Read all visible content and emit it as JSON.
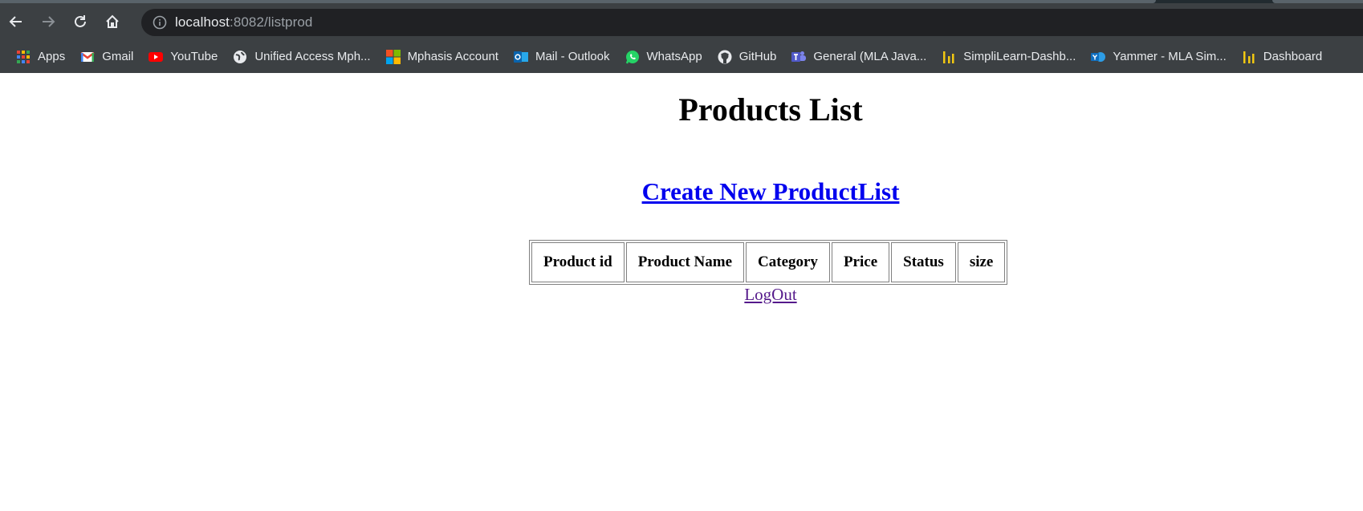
{
  "browser": {
    "url_host": "localhost",
    "url_rest": ":8082/listprod",
    "bookmarks": [
      {
        "label": "Apps",
        "icon": "apps-grid-icon"
      },
      {
        "label": "Gmail",
        "icon": "gmail-icon"
      },
      {
        "label": "YouTube",
        "icon": "youtube-icon"
      },
      {
        "label": "Unified Access Mph...",
        "icon": "globe-icon"
      },
      {
        "label": "Mphasis Account",
        "icon": "microsoft-icon"
      },
      {
        "label": "Mail - Outlook",
        "icon": "outlook-icon"
      },
      {
        "label": "WhatsApp",
        "icon": "whatsapp-icon"
      },
      {
        "label": "GitHub",
        "icon": "github-icon"
      },
      {
        "label": "General (MLA Java...",
        "icon": "teams-icon"
      },
      {
        "label": "SimpliLearn-Dashb...",
        "icon": "dashboard-bars-icon"
      },
      {
        "label": "Yammer - MLA Sim...",
        "icon": "yammer-icon"
      },
      {
        "label": "Dashboard",
        "icon": "dashboard-bars-icon"
      }
    ]
  },
  "page": {
    "title": "Products List",
    "create_link": "Create New ProductList",
    "columns": [
      "Product id",
      "Product Name",
      "Category",
      "Price",
      "Status",
      "size"
    ],
    "logout": "LogOut"
  },
  "colors": {
    "link": "#0000ee",
    "visited_link": "#551a8b",
    "toolbar_bg": "#3c4043"
  }
}
